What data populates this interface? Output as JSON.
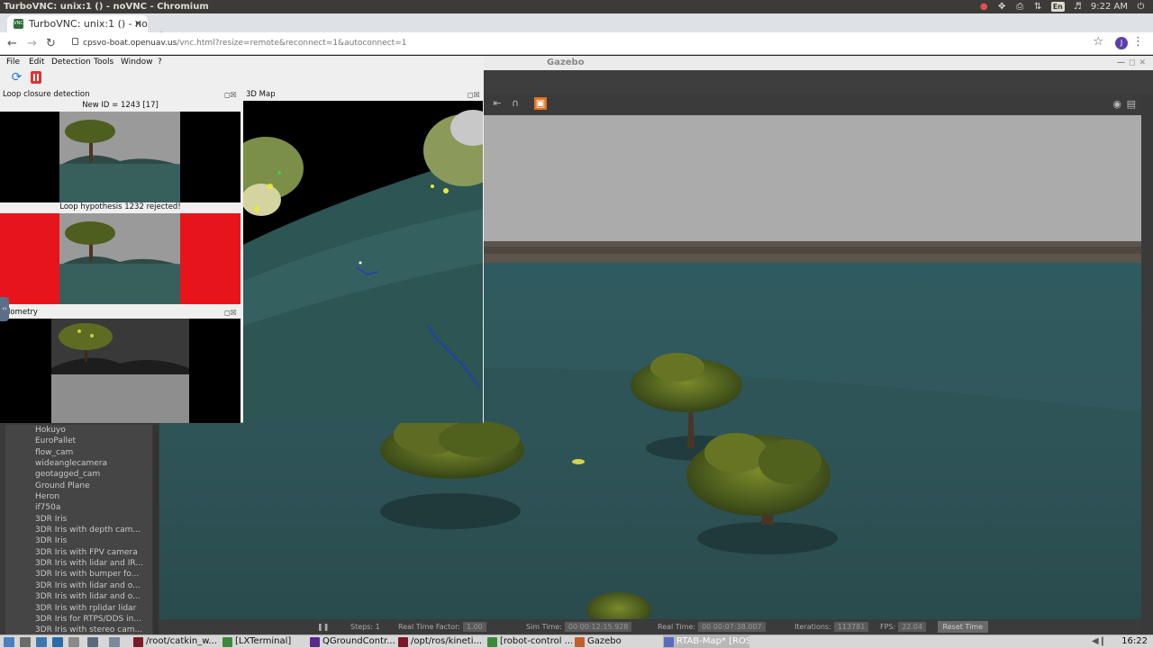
{
  "os": {
    "window_title": "TurboVNC: unix:1 () - noVNC - Chromium",
    "lang": "En",
    "clock": "9:22 AM"
  },
  "browser": {
    "tab_title": "TurboVNC: unix:1 () - noV",
    "tab_favicon": "VNC",
    "url_host": "cpsvo-boat.openuav.us",
    "url_path": "/vnc.html?resize=remote&reconnect=1&autoconnect=1",
    "profile_initial": "J"
  },
  "rtabmap": {
    "menu": [
      "File",
      "Edit",
      "Detection",
      "Tools",
      "Window",
      "?"
    ],
    "loop_closure": {
      "title": "Loop closure detection",
      "new_id": "New ID = 1243 [17]",
      "hypothesis": "Loop hypothesis 1232 rejected!"
    },
    "map3d_title": "3D Map",
    "odometry_title": "dometry",
    "side_handle": "‹›"
  },
  "gazebo": {
    "title": "Gazebo",
    "models": [
      "Hokuyo",
      "EuroPallet",
      "flow_cam",
      "wideanglecamera",
      "geotagged_cam",
      "Ground Plane",
      "Heron",
      "if750a",
      "3DR Iris",
      "3DR Iris with depth cam...",
      "3DR Iris",
      "3DR Iris with FPV camera",
      "3DR Iris with lidar and IR...",
      "3DR Iris with bumper fo...",
      "3DR Iris with lidar and o...",
      "3DR Iris with lidar and o...",
      "3DR Iris with rplidar lidar",
      "3DR Iris for RTPS/DDS in...",
      "3DR Iris with stereo cam..."
    ],
    "bottom": {
      "steps_label": "Steps:",
      "steps_value": "1",
      "rtf_label": "Real Time Factor:",
      "rtf_value": "1.00",
      "sim_label": "Sim Time:",
      "sim_value": "00 00:12:15.928",
      "real_label": "Real Time:",
      "real_value": "00 00:07:38.007",
      "iter_label": "Iterations:",
      "iter_value": "113781",
      "fps_label": "FPS:",
      "fps_value": "22.04",
      "reset_label": "Reset Time"
    }
  },
  "taskbar": {
    "tasks": [
      {
        "label": "/root/catkin_w..."
      },
      {
        "label": "[LXTerminal]"
      },
      {
        "label": "QGroundContr..."
      },
      {
        "label": "/opt/ros/kineti..."
      },
      {
        "label": "[robot-control ..."
      },
      {
        "label": "Gazebo"
      },
      {
        "label": "RTAB-Map* [ROS]"
      }
    ],
    "clock": "16:22"
  }
}
